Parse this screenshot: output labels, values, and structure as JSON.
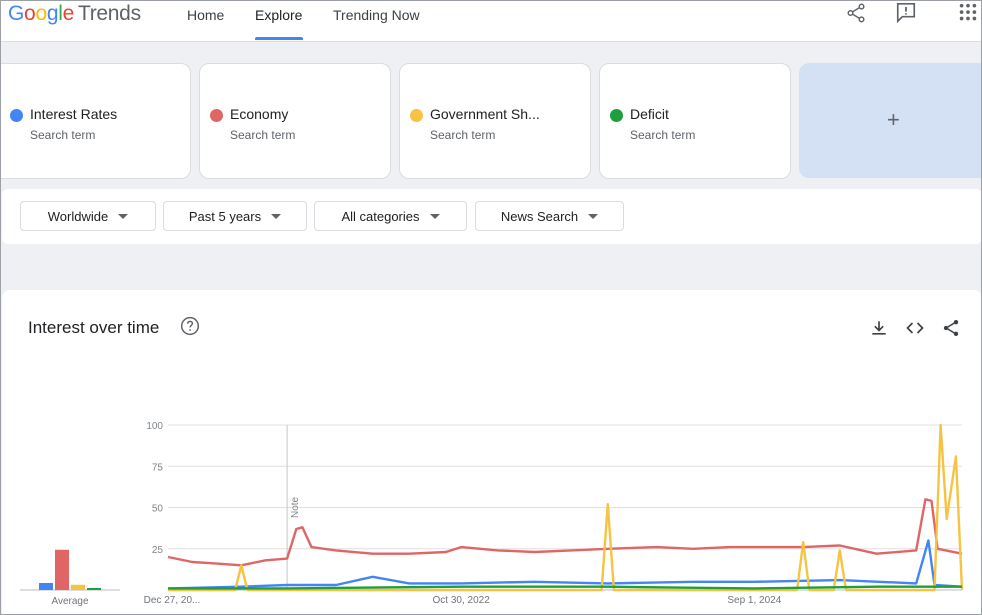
{
  "header": {
    "logo_google": [
      "G",
      "o",
      "o",
      "g",
      "l",
      "e"
    ],
    "logo_trends": "Trends",
    "nav": [
      {
        "label": "Home"
      },
      {
        "label": "Explore"
      },
      {
        "label": "Trending Now"
      }
    ],
    "icons": [
      "share-icon",
      "feedback-icon",
      "apps-grid-icon"
    ]
  },
  "terms": [
    {
      "name": "Interest Rates",
      "sub": "Search term",
      "color": "#4285f4"
    },
    {
      "name": "Economy",
      "sub": "Search term",
      "color": "#e06666"
    },
    {
      "name": "Government Sh...",
      "sub": "Search term",
      "color": "#f6c343"
    },
    {
      "name": "Deficit",
      "sub": "Search term",
      "color": "#1e9e3e"
    }
  ],
  "add_term": {
    "label": "+"
  },
  "filters": [
    {
      "label": "Worldwide"
    },
    {
      "label": "Past 5 years"
    },
    {
      "label": "All categories"
    },
    {
      "label": "News Search"
    }
  ],
  "chart": {
    "title": "Interest over time",
    "tools": [
      "download-icon",
      "embed-icon",
      "share-icon"
    ],
    "note_label": "Note",
    "average_label": "Average"
  },
  "chart_data": {
    "type": "line",
    "y_ticks": [
      25,
      50,
      75,
      100
    ],
    "ylim": [
      0,
      100
    ],
    "x_tick_labels": [
      "Dec 27, 20...",
      "Oct 30, 2022",
      "Sep 1, 2024"
    ],
    "x_range": [
      "2020-12-27",
      "2025-12-21"
    ],
    "x_tick_dates": [
      "2020-12-27",
      "2022-10-30",
      "2024-09-01"
    ],
    "note_date": "2021-09-26",
    "averages": [
      {
        "name": "Interest Rates",
        "value": 4
      },
      {
        "name": "Economy",
        "value": 23
      },
      {
        "name": "Government Sh...",
        "value": 3
      },
      {
        "name": "Deficit",
        "value": 1
      }
    ],
    "series": [
      {
        "name": "Economy",
        "color": "#e06666",
        "points": [
          [
            "2020-12-27",
            20
          ],
          [
            "2021-02-21",
            17
          ],
          [
            "2021-04-18",
            16
          ],
          [
            "2021-06-13",
            15
          ],
          [
            "2021-08-08",
            18
          ],
          [
            "2021-09-26",
            19
          ],
          [
            "2021-10-17",
            37
          ],
          [
            "2021-10-31",
            38
          ],
          [
            "2021-11-21",
            26
          ],
          [
            "2022-01-16",
            24
          ],
          [
            "2022-04-10",
            22
          ],
          [
            "2022-07-03",
            22
          ],
          [
            "2022-09-25",
            23
          ],
          [
            "2022-10-30",
            26
          ],
          [
            "2023-01-22",
            24
          ],
          [
            "2023-04-16",
            23
          ],
          [
            "2023-07-09",
            24
          ],
          [
            "2023-10-01",
            25
          ],
          [
            "2024-01-21",
            26
          ],
          [
            "2024-04-14",
            25
          ],
          [
            "2024-07-07",
            26
          ],
          [
            "2024-09-01",
            26
          ],
          [
            "2024-12-22",
            26
          ],
          [
            "2025-03-16",
            27
          ],
          [
            "2025-06-08",
            22
          ],
          [
            "2025-09-07",
            24
          ],
          [
            "2025-09-28",
            55
          ],
          [
            "2025-10-12",
            54
          ],
          [
            "2025-10-26",
            25
          ],
          [
            "2025-12-21",
            22
          ]
        ]
      },
      {
        "name": "Interest Rates",
        "color": "#4285f4",
        "points": [
          [
            "2020-12-27",
            1
          ],
          [
            "2021-06-13",
            2
          ],
          [
            "2021-09-26",
            3
          ],
          [
            "2022-01-16",
            3
          ],
          [
            "2022-04-10",
            8
          ],
          [
            "2022-07-03",
            4
          ],
          [
            "2022-10-30",
            4
          ],
          [
            "2023-04-16",
            5
          ],
          [
            "2023-10-01",
            4
          ],
          [
            "2024-04-14",
            5
          ],
          [
            "2024-09-01",
            5
          ],
          [
            "2025-03-16",
            6
          ],
          [
            "2025-09-07",
            4
          ],
          [
            "2025-10-05",
            30
          ],
          [
            "2025-10-19",
            3
          ],
          [
            "2025-12-21",
            2
          ]
        ]
      },
      {
        "name": "Government Sh...",
        "color": "#f6c343",
        "points": [
          [
            "2020-12-27",
            0
          ],
          [
            "2021-05-30",
            0
          ],
          [
            "2021-06-13",
            15
          ],
          [
            "2021-06-27",
            0
          ],
          [
            "2023-09-17",
            0
          ],
          [
            "2023-10-01",
            52
          ],
          [
            "2023-10-15",
            0
          ],
          [
            "2024-12-08",
            0
          ],
          [
            "2024-12-22",
            29
          ],
          [
            "2025-01-05",
            0
          ],
          [
            "2025-03-02",
            0
          ],
          [
            "2025-03-16",
            24
          ],
          [
            "2025-03-30",
            0
          ],
          [
            "2025-10-19",
            0
          ],
          [
            "2025-11-02",
            100
          ],
          [
            "2025-11-16",
            43
          ],
          [
            "2025-12-07",
            81
          ],
          [
            "2025-12-21",
            0
          ]
        ]
      },
      {
        "name": "Deficit",
        "color": "#1e9e3e",
        "points": [
          [
            "2020-12-27",
            1
          ],
          [
            "2021-09-26",
            1
          ],
          [
            "2022-10-30",
            2
          ],
          [
            "2023-10-01",
            2
          ],
          [
            "2024-09-01",
            1
          ],
          [
            "2025-06-08",
            2
          ],
          [
            "2025-12-21",
            2
          ]
        ]
      }
    ]
  }
}
